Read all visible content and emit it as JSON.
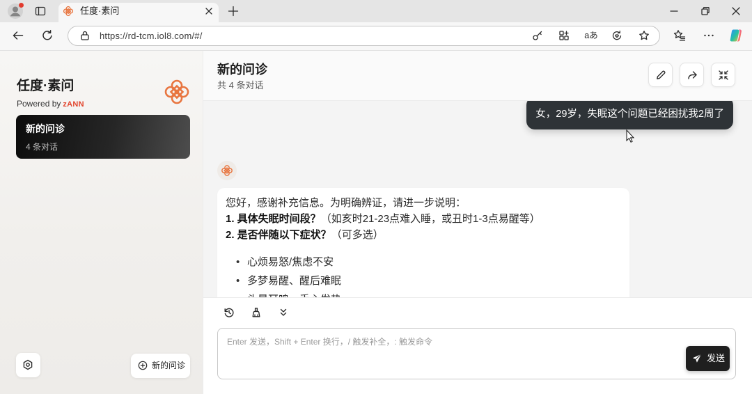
{
  "browser": {
    "tab": {
      "title": "任度·素问",
      "favicon": "suwen-logo-icon",
      "close_icon": "close-icon"
    },
    "new_tab_icon": "plus-icon",
    "address": {
      "url": "https://rd-tcm.iol8.com/#/",
      "read_aloud_label": "aあ",
      "icons": [
        "site-info-icon",
        "key-icon",
        "apps-icon",
        "browser-essentials-icon",
        "star-icon"
      ]
    },
    "toolbar_icons": [
      "back-icon",
      "refresh-icon",
      "favorites-icon",
      "more-icon",
      "copilot-icon"
    ],
    "window_controls": [
      "minimize-icon",
      "restore-icon",
      "window-close-icon"
    ]
  },
  "sidebar": {
    "brand_title": "任度·素问",
    "powered_by_prefix": "Powered by",
    "powered_by_brand": "zANN",
    "logo_icon": "suwen-logo-icon",
    "active_conversation": {
      "title": "新的问诊",
      "count_label": "4 条对话"
    },
    "settings_icon": "settings-icon",
    "new_consult_label": "新的问诊",
    "new_consult_icon": "plus-circle-icon"
  },
  "header": {
    "title": "新的问诊",
    "subtitle": "共 4 条对话",
    "actions": [
      "edit-icon",
      "share-icon",
      "collapse-icon"
    ]
  },
  "chat": {
    "user_message": "女，29岁，失眠这个问题已经困扰我2周了",
    "bot_message": {
      "intro": "您好，感谢补充信息。为明确辨证，请进一步说明：",
      "questions": [
        {
          "label": "1. 具体失眠时间段？",
          "detail": "（如亥时21-23点难入睡，或丑时1-3点易醒等）"
        },
        {
          "label": "2. 是否伴随以下症状？",
          "detail": "（可多选）"
        }
      ],
      "options": [
        "心烦易怒/焦虑不安",
        "多梦易醒、醒后难眠",
        "头晕耳鸣、手心发热"
      ]
    }
  },
  "composer": {
    "tools": [
      "history-icon",
      "clear-icon",
      "chevrons-down-icon"
    ],
    "placeholder": "Enter 发送，Shift + Enter 换行，/ 触发补全，: 触发命令",
    "send_label": "发送",
    "send_icon": "send-icon"
  },
  "colors": {
    "accent": "#e8753f",
    "brand_red": "#e2462f",
    "user_bubble": "#2e3337",
    "send_button": "#1f1f1f"
  }
}
